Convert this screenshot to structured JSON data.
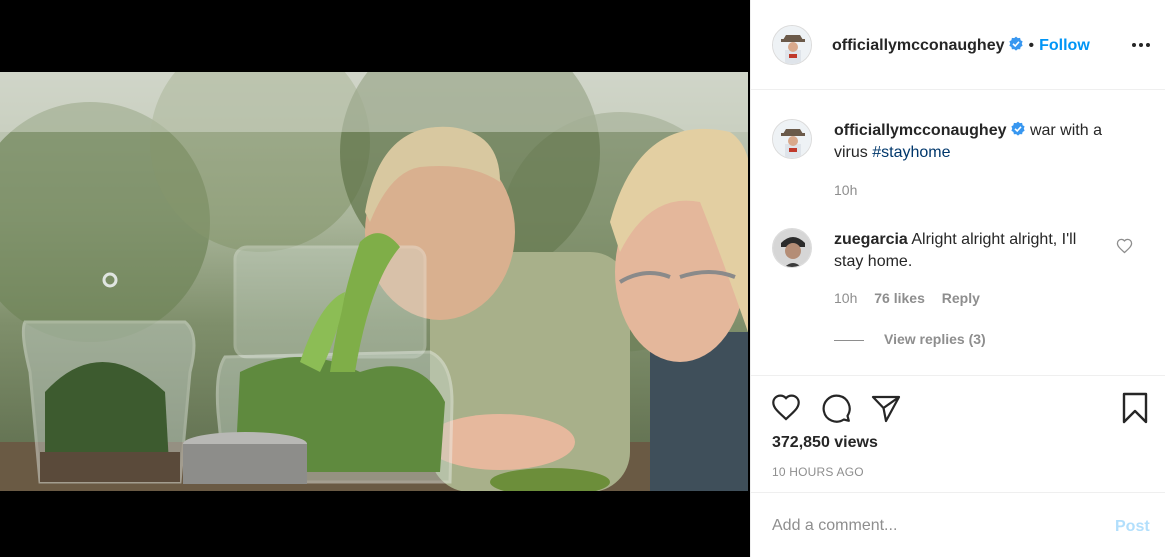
{
  "post": {
    "username": "officiallymcconaughey",
    "follow_label": "Follow",
    "separator": "•"
  },
  "caption": {
    "username": "officiallymcconaughey",
    "text": "war with a virus",
    "hashtag": "#stayhome",
    "time": "10h"
  },
  "comment": {
    "username": "zuegarcia",
    "text": "Alright alright alright, I'll stay home.",
    "time": "10h",
    "likes": "76 likes",
    "reply_label": "Reply",
    "view_replies": "View replies (3)"
  },
  "stats": {
    "views": "372,850 views",
    "posted": "10 HOURS AGO"
  },
  "add_comment": {
    "placeholder": "Add a comment...",
    "post_label": "Post"
  },
  "colors": {
    "link_blue": "#0095f6",
    "post_disabled": "#b2dffc",
    "hashtag": "#00376b",
    "muted": "#8e8e8e"
  },
  "icons": [
    "verified-badge-icon",
    "more-options-icon",
    "heart-icon",
    "comment-icon",
    "share-icon",
    "bookmark-icon"
  ]
}
